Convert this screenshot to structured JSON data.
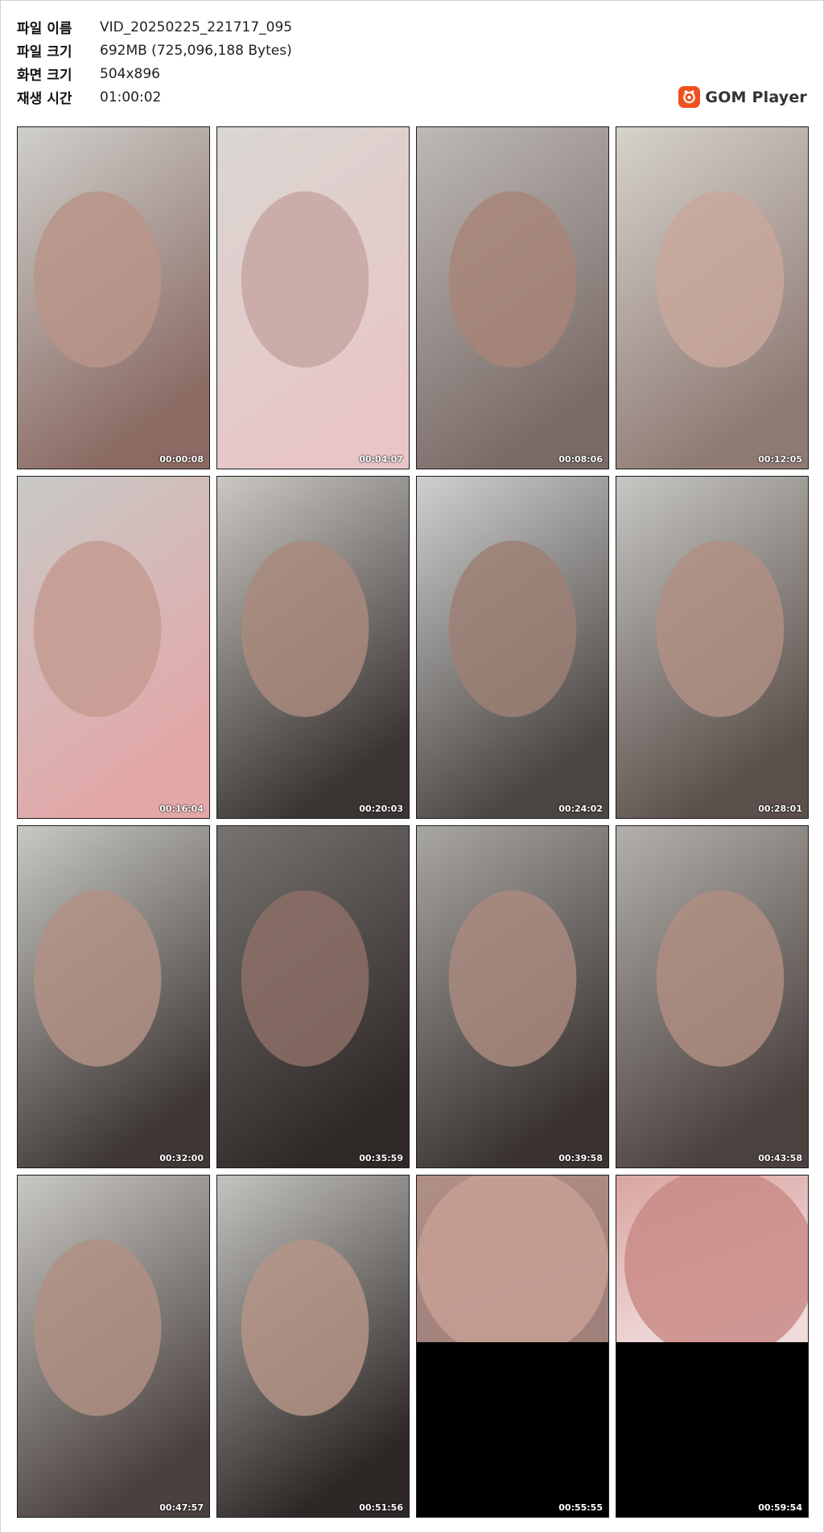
{
  "info": {
    "rows": [
      {
        "label": "파일 이름",
        "value": "VID_20250225_221717_095"
      },
      {
        "label": "파일 크기",
        "value": "692MB (725,096,188 Bytes)"
      },
      {
        "label": "화면 크기",
        "value": "504x896"
      },
      {
        "label": "재생 시간",
        "value": "01:00:02"
      }
    ]
  },
  "brand": {
    "name": "GOM Player",
    "icon": "gom-player-logo-icon",
    "color": "#f0501e"
  },
  "thumbnails": [
    {
      "time": "00:00:08",
      "frame": "close-face-pink",
      "split": false
    },
    {
      "time": "00:04:07",
      "frame": "lying-pillow",
      "split": false
    },
    {
      "time": "00:08:06",
      "frame": "lying-bed",
      "split": false
    },
    {
      "time": "00:12:05",
      "frame": "window-room",
      "split": false
    },
    {
      "time": "00:16:04",
      "frame": "hand-raised-pink",
      "split": false
    },
    {
      "time": "00:20:03",
      "frame": "looking-down",
      "split": false
    },
    {
      "time": "00:24:02",
      "frame": "hair-covering",
      "split": false
    },
    {
      "time": "00:28:01",
      "frame": "smiling",
      "split": false
    },
    {
      "time": "00:32:00",
      "frame": "hands-clasped",
      "split": false
    },
    {
      "time": "00:35:59",
      "frame": "dark-smiling",
      "split": false
    },
    {
      "time": "00:39:58",
      "frame": "tilted-smiling",
      "split": false
    },
    {
      "time": "00:43:58",
      "frame": "talking",
      "split": false
    },
    {
      "time": "00:47:57",
      "frame": "talking-2",
      "split": false
    },
    {
      "time": "00:51:56",
      "frame": "looking-camera",
      "split": false
    },
    {
      "time": "00:55:55",
      "frame": "close-up-black-bottom",
      "split": true
    },
    {
      "time": "00:59:54",
      "frame": "lips-black-bottom",
      "split": true
    }
  ]
}
